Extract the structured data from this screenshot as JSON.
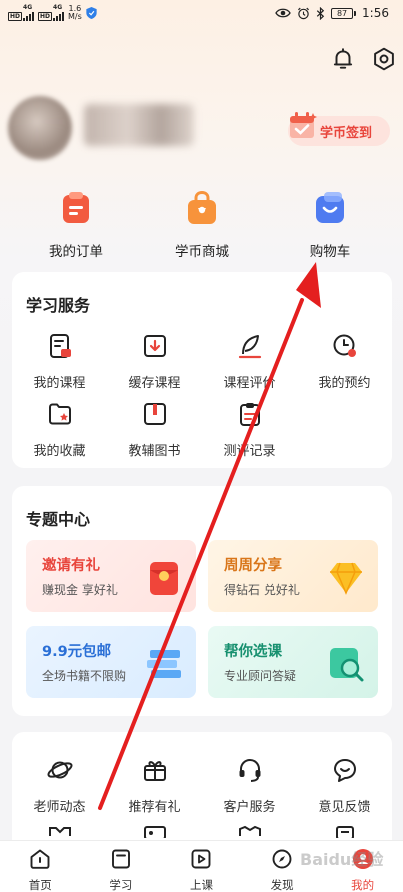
{
  "status_bar": {
    "sim1": "HD",
    "sim2": "HD",
    "net1": "4G",
    "net2": "4G",
    "speed_value": "1.6",
    "speed_unit": "M/s",
    "battery": "87",
    "time": "1:56"
  },
  "header": {
    "bell_icon": "bell-icon",
    "settings_icon": "settings-icon"
  },
  "profile": {
    "checkin_label": "学币签到"
  },
  "quick_actions": [
    {
      "label": "我的订单",
      "icon": "order-icon",
      "color": "#f25b40"
    },
    {
      "label": "学币商城",
      "icon": "shop-bag-icon",
      "color": "#f7933b"
    },
    {
      "label": "购物车",
      "icon": "cart-icon",
      "color": "#4f7bf0"
    }
  ],
  "learning_services": {
    "title": "学习服务",
    "items": [
      {
        "label": "我的课程",
        "icon": "my-course-icon"
      },
      {
        "label": "缓存课程",
        "icon": "download-icon"
      },
      {
        "label": "课程评价",
        "icon": "review-feather-icon"
      },
      {
        "label": "我的预约",
        "icon": "appointment-clock-icon"
      },
      {
        "label": "我的收藏",
        "icon": "favorite-folder-icon"
      },
      {
        "label": "教辅图书",
        "icon": "book-icon"
      },
      {
        "label": "测评记录",
        "icon": "test-record-icon"
      }
    ]
  },
  "topic_center": {
    "title": "专题中心",
    "promos": [
      {
        "title": "邀请有礼",
        "subtitle": "赚现金 享好礼",
        "title_color": "#e8453c",
        "icon": "red-envelope-icon"
      },
      {
        "title": "周周分享",
        "subtitle": "得钻石 兑好礼",
        "title_color": "#d9761a",
        "icon": "diamond-icon"
      },
      {
        "title": "9.9元包邮",
        "subtitle": "全场书籍不限购",
        "title_color": "#2a6fd6",
        "icon": "books-icon"
      },
      {
        "title": "帮你选课",
        "subtitle": "专业顾问答疑",
        "title_color": "#17906f",
        "icon": "course-search-icon"
      }
    ]
  },
  "more_services": {
    "items": [
      {
        "label": "老师动态",
        "icon": "planet-icon"
      },
      {
        "label": "推荐有礼",
        "icon": "gift-icon"
      },
      {
        "label": "客户服务",
        "icon": "headset-icon"
      },
      {
        "label": "意见反馈",
        "icon": "feedback-icon"
      }
    ]
  },
  "bottom_nav": [
    {
      "label": "首页",
      "icon": "home-icon"
    },
    {
      "label": "学习",
      "icon": "study-icon"
    },
    {
      "label": "上课",
      "icon": "play-class-icon"
    },
    {
      "label": "发现",
      "icon": "discover-icon"
    },
    {
      "label": "我的",
      "icon": "me-icon",
      "active": true
    }
  ],
  "watermark": "Baidu经验",
  "colors": {
    "accent_red": "#e8453c",
    "arrow_red": "#e41f1f"
  }
}
